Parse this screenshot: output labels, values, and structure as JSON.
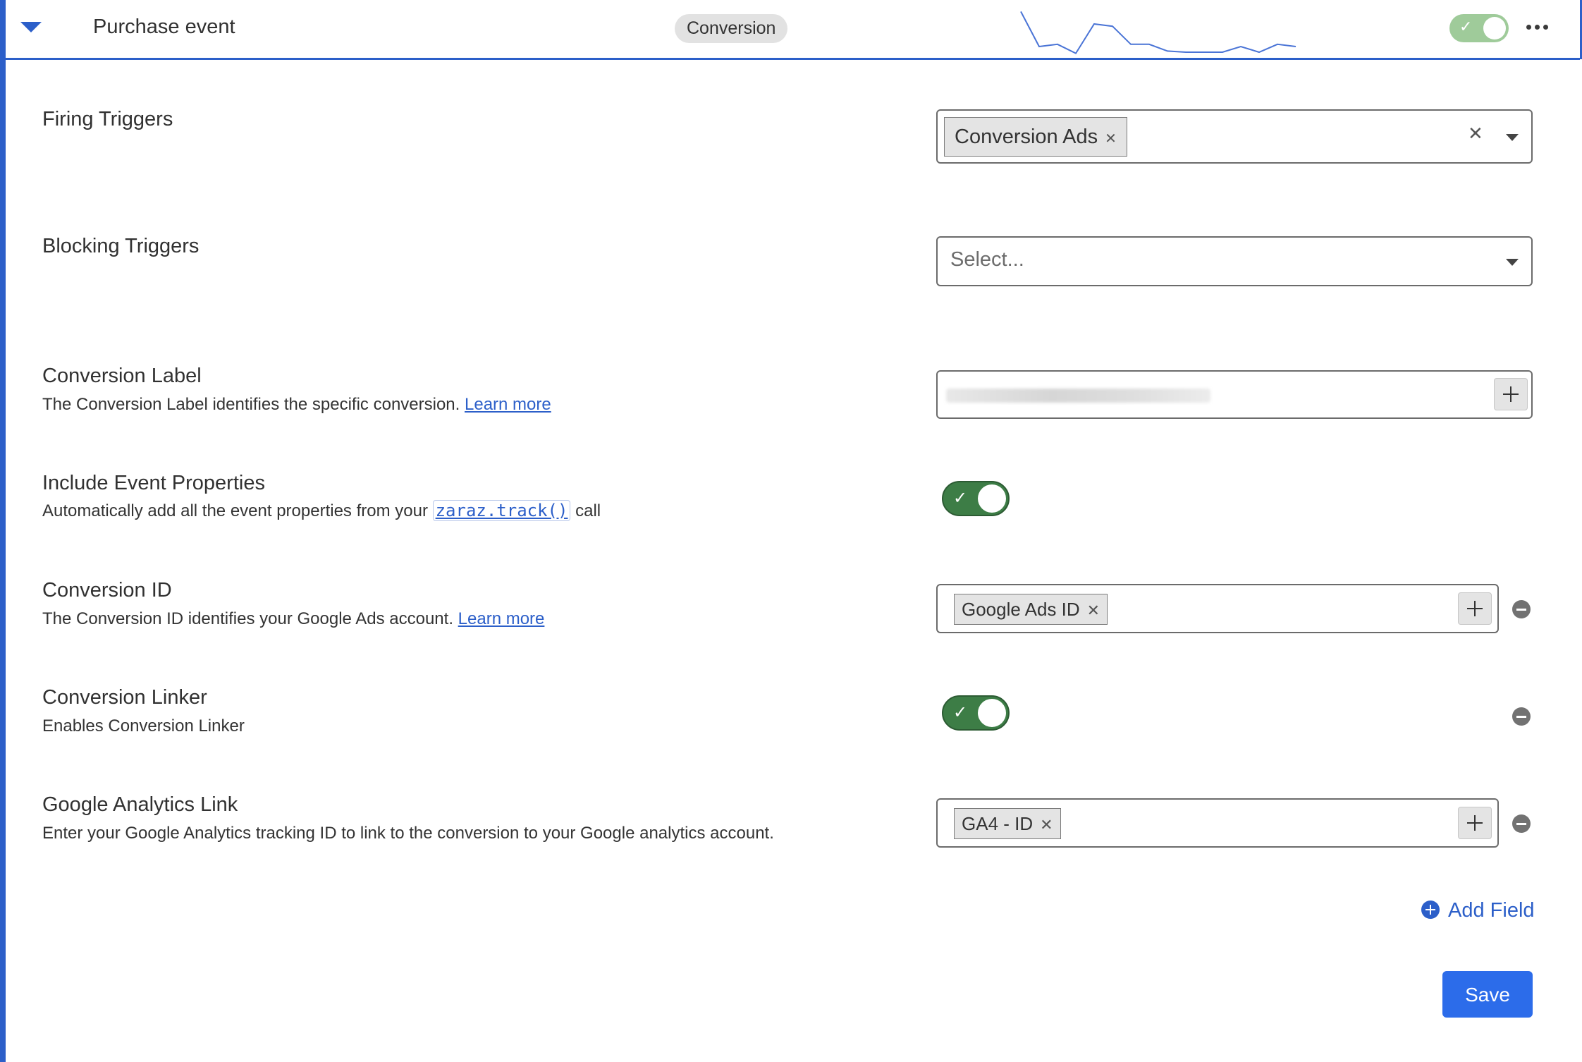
{
  "header": {
    "title": "Purchase event",
    "badge": "Conversion",
    "sparkline": [
      9,
      40,
      38,
      46,
      20,
      22,
      38,
      38,
      44,
      45,
      45,
      45,
      40,
      45,
      38,
      40
    ],
    "enabled": true
  },
  "fields": {
    "firing_triggers": {
      "label": "Firing Triggers",
      "selected": [
        "Conversion Ads"
      ]
    },
    "blocking_triggers": {
      "label": "Blocking Triggers",
      "placeholder": "Select..."
    },
    "conversion_label": {
      "label": "Conversion Label",
      "description": "The Conversion Label identifies the specific conversion.",
      "link": "Learn more"
    },
    "include_event_properties": {
      "label": "Include Event Properties",
      "description_before": "Automatically add all the event properties from your",
      "code": "zaraz.track()",
      "description_after": "call",
      "enabled": true
    },
    "conversion_id": {
      "label": "Conversion ID",
      "description": "The Conversion ID identifies your Google Ads account.",
      "link": "Learn more",
      "chip": "Google Ads ID"
    },
    "conversion_linker": {
      "label": "Conversion Linker",
      "description": "Enables Conversion Linker",
      "enabled": true
    },
    "google_analytics_link": {
      "label": "Google Analytics Link",
      "description": "Enter your Google Analytics tracking ID to link to the conversion to your Google analytics account.",
      "chip": "GA4 - ID"
    }
  },
  "actions": {
    "add_field": "Add Field",
    "save": "Save"
  },
  "colors": {
    "accent": "#2c5fc9",
    "toggle_on": "#3d7d46",
    "save_button": "#2c6cea"
  }
}
